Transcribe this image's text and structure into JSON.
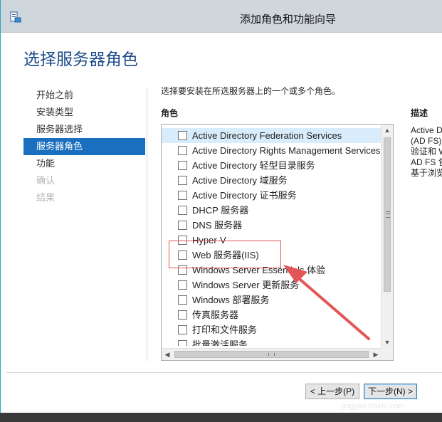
{
  "window": {
    "title": "添加角色和功能向导",
    "icon": "server-manager-icon"
  },
  "page": {
    "title": "选择服务器角色",
    "instruction": "选择要安装在所选服务器上的一个或多个角色。"
  },
  "nav": {
    "items": [
      {
        "label": "开始之前",
        "state": "normal"
      },
      {
        "label": "安装类型",
        "state": "normal"
      },
      {
        "label": "服务器选择",
        "state": "normal"
      },
      {
        "label": "服务器角色",
        "state": "selected"
      },
      {
        "label": "功能",
        "state": "normal"
      },
      {
        "label": "确认",
        "state": "disabled"
      },
      {
        "label": "结果",
        "state": "disabled"
      }
    ]
  },
  "roles": {
    "header": "角色",
    "items": [
      {
        "label": "Active Directory Federation Services",
        "checked": false,
        "selected": true
      },
      {
        "label": "Active Directory Rights Management Services",
        "checked": false,
        "selected": false
      },
      {
        "label": "Active Directory 轻型目录服务",
        "checked": false,
        "selected": false
      },
      {
        "label": "Active Directory 域服务",
        "checked": false,
        "selected": false
      },
      {
        "label": "Active Directory 证书服务",
        "checked": false,
        "selected": false
      },
      {
        "label": "DHCP 服务器",
        "checked": false,
        "selected": false
      },
      {
        "label": "DNS 服务器",
        "checked": false,
        "selected": false
      },
      {
        "label": "Hyper-V",
        "checked": false,
        "selected": false
      },
      {
        "label": "Web 服务器(IIS)",
        "checked": false,
        "selected": false
      },
      {
        "label": "Windows Server Essentials 体验",
        "checked": false,
        "selected": false
      },
      {
        "label": "Windows Server 更新服务",
        "checked": false,
        "selected": false
      },
      {
        "label": "Windows 部署服务",
        "checked": false,
        "selected": false
      },
      {
        "label": "传真服务器",
        "checked": false,
        "selected": false
      },
      {
        "label": "打印和文件服务",
        "checked": false,
        "selected": false
      },
      {
        "label": "批量激活服务",
        "checked": false,
        "selected": false
      }
    ]
  },
  "description": {
    "header": "描述",
    "lines": [
      "Active D",
      "(AD FS)",
      "验证和 W",
      "AD FS 包",
      "基于浏览"
    ]
  },
  "buttons": {
    "previous": "< 上一步(P)",
    "next": "下一步(N) >"
  },
  "watermark": "jingyan.baidu.com",
  "colors": {
    "accent": "#1a6fbf",
    "title": "#1d4b8a",
    "annotation": "#e45555"
  }
}
